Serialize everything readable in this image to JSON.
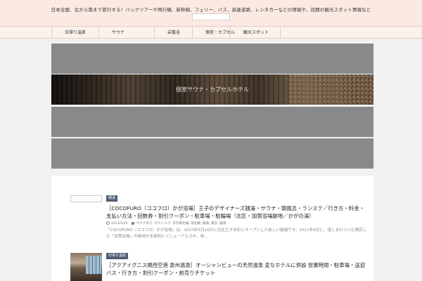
{
  "header": {
    "tagline": "日本全国、北から南まで旅行する！バックツアーや飛行機、新幹線、フェリー、バス、高速道路、レンタカーなどの情報や、話題の観光スポット情報など",
    "search_placeholder": ""
  },
  "nav": {
    "items": [
      "日帰り温泉",
      "サウナ",
      "岩盤浴",
      "個室・カプセル",
      "観光スポット"
    ]
  },
  "banners": {
    "b2_title": "個室サウナ・カプセルホテル"
  },
  "posts": [
    {
      "category": "銭湯",
      "title": "［COCOFURO（ココフロ）かが浴場］王子のデザイナーズ銭湯・サウナ・朝風呂・ランステ／行き方・料金・支払い方法・回数券・割引クーポン・駐車場・駐輪場（北区・加賀浴場跡地／かがの湯）",
      "date": "2023/5/22",
      "tags": "サウナあり, ロウリュウ, 京浜東北線, 南北線, 銭湯, 東京, 銭湯",
      "excerpt": "「COCOFURO（ココフロ）かが浴場」は、2023年5月16日に北区王子本町にオープンした新しい銭湯です。2021年4月に、惜しまれつつも閉店した「加賀浴場」の跡地が全面的にリニューアルされ、新…"
    },
    {
      "category": "日帰り温泉",
      "title": "［アクアイグニス関西空港 泉州温泉］オーシャンビューの天然温泉 変なホテルに併設 営業時間・駐車場・送迎バス・行き方・割引クーポン・前売りチケット"
    }
  ]
}
